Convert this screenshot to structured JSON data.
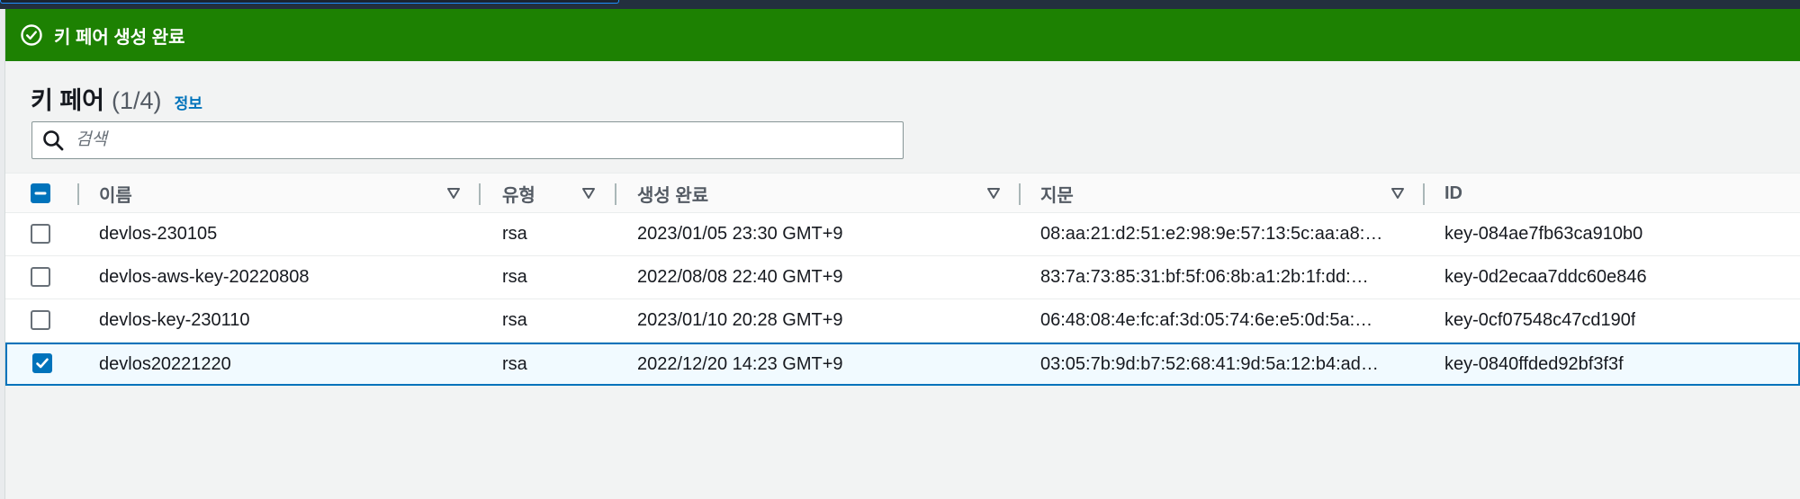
{
  "flash": {
    "message": "키 페어 생성 완료",
    "icon": "check-circle-icon",
    "color": "#1d8102"
  },
  "header": {
    "title": "키 페어",
    "count": "(1/4)",
    "info_link": "정보"
  },
  "search": {
    "placeholder": "검색",
    "value": ""
  },
  "table": {
    "columns": [
      {
        "label": "이름",
        "sortable": true
      },
      {
        "label": "유형",
        "sortable": true
      },
      {
        "label": "생성 완료",
        "sortable": true
      },
      {
        "label": "지문",
        "sortable": true
      },
      {
        "label": "ID",
        "sortable": false
      }
    ],
    "header_checkbox": "indeterminate",
    "rows": [
      {
        "checked": false,
        "name": "devlos-230105",
        "type": "rsa",
        "created": "2023/01/05 23:30 GMT+9",
        "fingerprint": "08:aa:21:d2:51:e2:98:9e:57:13:5c:aa:a8:…",
        "id": "key-084ae7fb63ca910b0"
      },
      {
        "checked": false,
        "name": "devlos-aws-key-20220808",
        "type": "rsa",
        "created": "2022/08/08 22:40 GMT+9",
        "fingerprint": "83:7a:73:85:31:bf:5f:06:8b:a1:2b:1f:dd:…",
        "id": "key-0d2ecaa7ddc60e846"
      },
      {
        "checked": false,
        "name": "devlos-key-230110",
        "type": "rsa",
        "created": "2023/01/10 20:28 GMT+9",
        "fingerprint": "06:48:08:4e:fc:af:3d:05:74:6e:e5:0d:5a:…",
        "id": "key-0cf07548c47cd190f"
      },
      {
        "checked": true,
        "name": "devlos20221220",
        "type": "rsa",
        "created": "2022/12/20 14:23 GMT+9",
        "fingerprint": "03:05:7b:9d:b7:52:68:41:9d:5a:12:b4:ad…",
        "id": "key-0840ffded92bf3f3f"
      }
    ]
  },
  "colors": {
    "accent": "#0073bb",
    "success": "#1d8102",
    "topbar": "#232f3e"
  }
}
